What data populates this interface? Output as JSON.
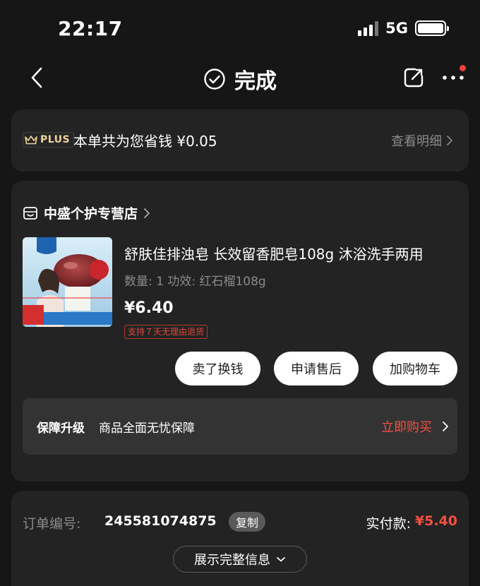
{
  "status_bar": {
    "time": "22:17",
    "network": "5G"
  },
  "nav": {
    "title": "完成",
    "icons": [
      "back-chevron-icon",
      "check-circle-icon",
      "share-icon",
      "more-icon"
    ]
  },
  "plus": {
    "badge": "PLUS",
    "message": "本单共为您省钱 ¥0.05",
    "link": "查看明细"
  },
  "order": {
    "store_name": "中盛个护专营店",
    "product": {
      "title": "舒肤佳排浊皂 长效留香肥皂108g 沐浴洗手两用",
      "spec": "数量: 1  功效: 红石榴108g",
      "price": "¥6.40",
      "return_tag": "支持７天无理由退货",
      "image_badge": "三重\n排浊",
      "image_caption": "排浊净焕 焕活肌肤",
      "image_seal": "红米配\n排浊"
    },
    "buttons": {
      "sell": "卖了换钱",
      "after_sale": "申请售后",
      "add_cart": "加购物车"
    },
    "guarantee": {
      "title": "保障升级",
      "desc": "商品全面无忧保障",
      "buy": "立即购买"
    }
  },
  "info": {
    "order_no_label": "订单编号:",
    "order_no": "245581074875",
    "copy": "复制",
    "paid_label": "实付款:",
    "paid_value": "¥5.40",
    "expand": "展示完整信息"
  },
  "colors": {
    "background": "#161616",
    "card": "#232323",
    "accent_red": "#f2503f",
    "plus_gold": "#f3d29c",
    "muted_text": "#8a8a8a"
  }
}
